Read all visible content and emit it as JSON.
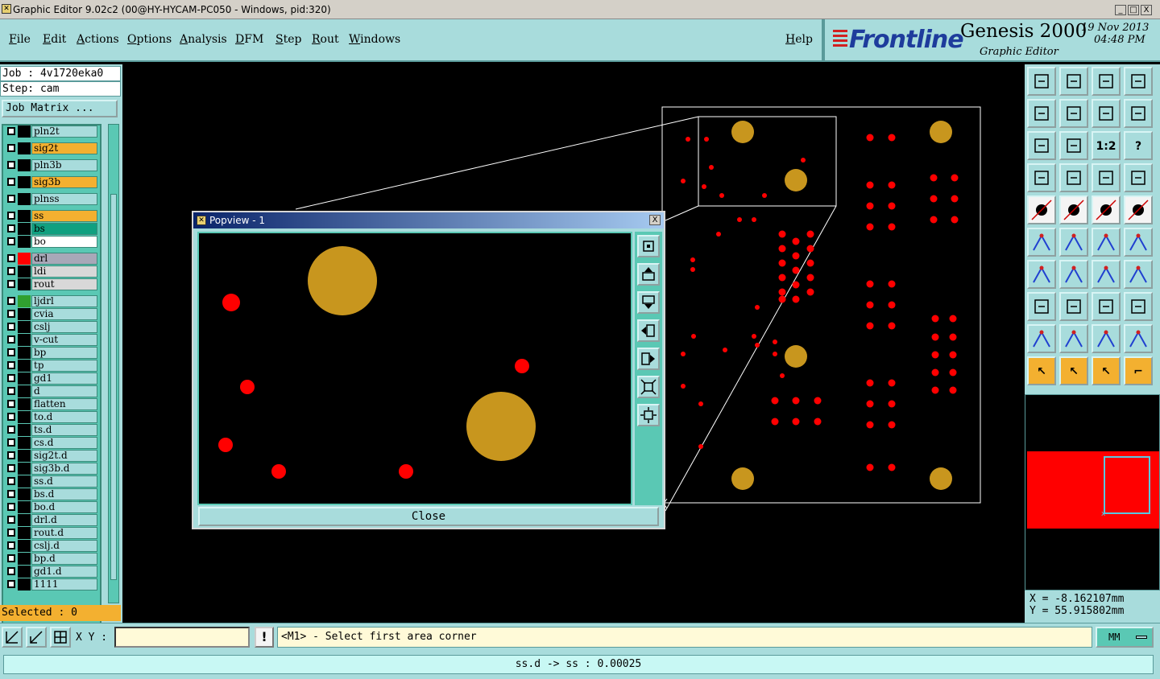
{
  "window": {
    "title": "Graphic Editor 9.02c2 (00@HY-HYCAM-PC050 - Windows, pid:320)",
    "controls": [
      "_",
      "□",
      "X"
    ]
  },
  "menu": {
    "items": [
      "File",
      "Edit",
      "Actions",
      "Options",
      "Analysis",
      "DFM",
      "Step",
      "Rout",
      "Windows"
    ],
    "help": "Help"
  },
  "brand": {
    "logo": "Frontline",
    "product": "Genesis 2000",
    "subtitle": "Graphic Editor",
    "date": "19 Nov 2013",
    "time": "04:48 PM"
  },
  "job": {
    "job_line": "Job : 4v1720eka0",
    "step_line": "Step: cam",
    "matrix_button": "Job Matrix ..."
  },
  "layers": [
    {
      "name": "pln2t",
      "color": "#a8dcdc",
      "box": "#000000"
    },
    {
      "name": "sig2t",
      "color": "#f3b030",
      "box": "#000000"
    },
    {
      "name": "pln3b",
      "color": "#a8dcdc",
      "box": "#000000"
    },
    {
      "name": "sig3b",
      "color": "#f3b030",
      "box": "#000000"
    },
    {
      "name": "plnss",
      "color": "#a8dcdc",
      "box": "#000000"
    },
    {
      "name": "ss",
      "color": "#f3b030",
      "box": "#000000"
    },
    {
      "name": "bs",
      "color": "#10a080",
      "box": "#000000"
    },
    {
      "name": "bo",
      "color": "#ffffff",
      "box": "#000000"
    },
    {
      "name": "drl",
      "color": "#a8a8b8",
      "box": "#ff0000"
    },
    {
      "name": "ldi",
      "color": "#d8d8d8",
      "box": "#000000"
    },
    {
      "name": "rout",
      "color": "#d8d8d8",
      "box": "#000000"
    },
    {
      "name": "ljdrl",
      "color": "#a8dcdc",
      "box": "#30a030"
    },
    {
      "name": "cvia",
      "color": "#a8dcdc",
      "box": "#000000"
    },
    {
      "name": "cslj",
      "color": "#a8dcdc",
      "box": "#000000"
    },
    {
      "name": "v-cut",
      "color": "#a8dcdc",
      "box": "#000000"
    },
    {
      "name": "bp",
      "color": "#a8dcdc",
      "box": "#000000"
    },
    {
      "name": "tp",
      "color": "#a8dcdc",
      "box": "#000000"
    },
    {
      "name": "gd1",
      "color": "#a8dcdc",
      "box": "#000000"
    },
    {
      "name": "d",
      "color": "#a8dcdc",
      "box": "#000000"
    },
    {
      "name": "flatten",
      "color": "#a8dcdc",
      "box": "#000000"
    },
    {
      "name": "to.d",
      "color": "#a8dcdc",
      "box": "#000000"
    },
    {
      "name": "ts.d",
      "color": "#a8dcdc",
      "box": "#000000"
    },
    {
      "name": "cs.d",
      "color": "#a8dcdc",
      "box": "#000000"
    },
    {
      "name": "sig2t.d",
      "color": "#a8dcdc",
      "box": "#000000"
    },
    {
      "name": "sig3b.d",
      "color": "#a8dcdc",
      "box": "#000000"
    },
    {
      "name": "ss.d",
      "color": "#a8dcdc",
      "box": "#000000"
    },
    {
      "name": "bs.d",
      "color": "#a8dcdc",
      "box": "#000000"
    },
    {
      "name": "bo.d",
      "color": "#a8dcdc",
      "box": "#000000"
    },
    {
      "name": "drl.d",
      "color": "#a8dcdc",
      "box": "#000000"
    },
    {
      "name": "rout.d",
      "color": "#a8dcdc",
      "box": "#000000"
    },
    {
      "name": "cslj.d",
      "color": "#a8dcdc",
      "box": "#000000"
    },
    {
      "name": "bp.d",
      "color": "#a8dcdc",
      "box": "#000000"
    },
    {
      "name": "gd1.d",
      "color": "#a8dcdc",
      "box": "#000000"
    },
    {
      "name": "1111",
      "color": "#a8dcdc",
      "box": "#000000"
    }
  ],
  "selected": "Selected : 0",
  "popview": {
    "title": "Popview - 1",
    "close_button": "Close",
    "close_x": "X",
    "tools": [
      "zoom-home-icon",
      "pan-up-icon",
      "pan-down-icon",
      "pan-left-icon",
      "pan-right-icon",
      "zoom-in-icon",
      "zoom-out-icon"
    ]
  },
  "coords": {
    "x": "X = -8.162107mm",
    "y": "Y = 55.915802mm"
  },
  "bottom": {
    "xy_label": "X Y :",
    "xy_value": "",
    "warn": "!",
    "prompt": "<M1> - Select first area corner",
    "units": "MM",
    "status": "ss.d -> ss : 0.00025"
  },
  "colors": {
    "panel": "#a8dcdc",
    "pad_red": "#ff0000",
    "pad_gold": "#c8961e",
    "highlight": "#f3b030"
  }
}
